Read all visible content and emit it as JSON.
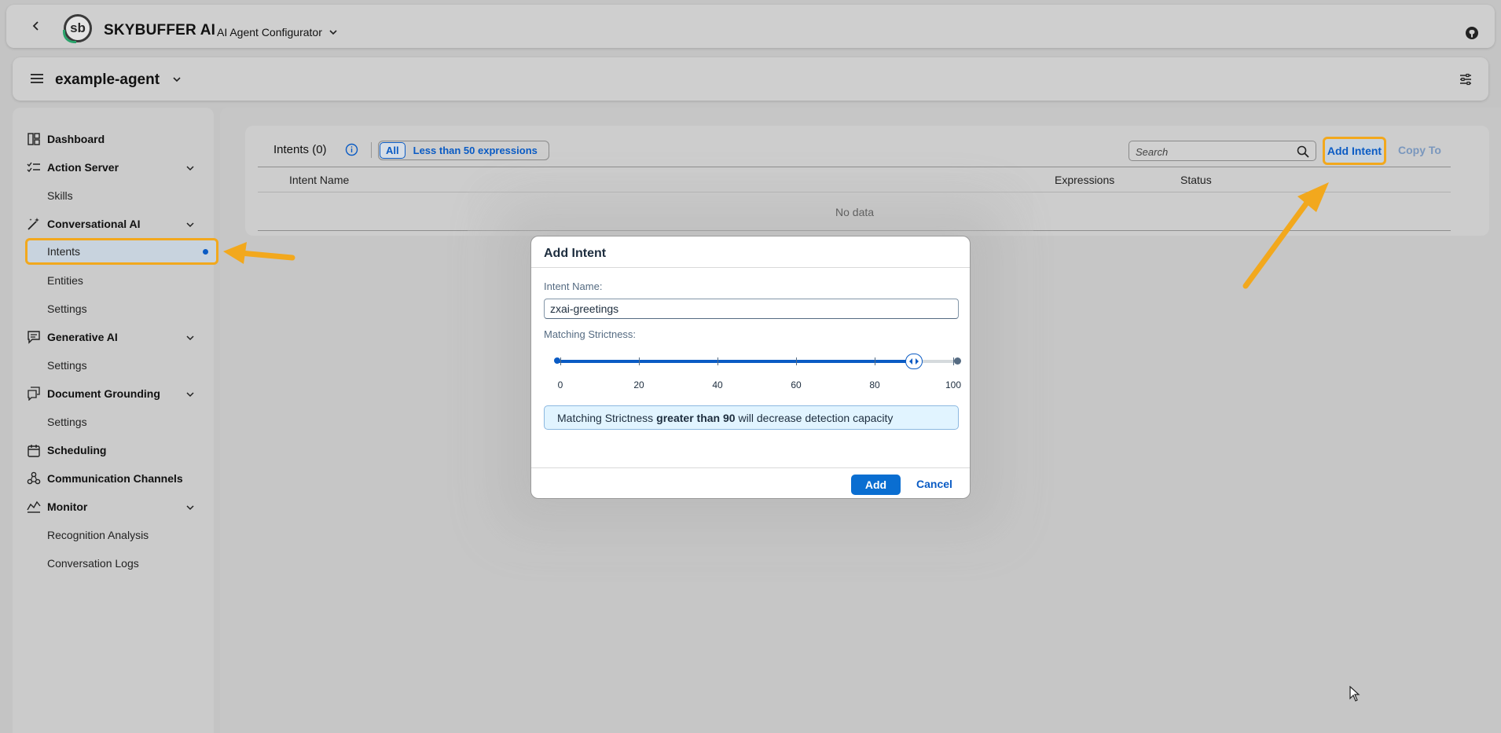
{
  "shellbar": {
    "brand": "SKYBUFFER AI",
    "logo_text": "sb",
    "product": "AI Agent Configurator"
  },
  "toolbar": {
    "agent_name": "example-agent"
  },
  "sidebar": {
    "items": [
      {
        "label": "Dashboard",
        "icon": "dashboard-icon"
      },
      {
        "label": "Action Server",
        "icon": "tasks-icon"
      },
      {
        "label": "Skills"
      },
      {
        "label": "Conversational AI",
        "icon": "magic-wand-icon"
      },
      {
        "label": "Intents"
      },
      {
        "label": "Entities"
      },
      {
        "label": "Settings"
      },
      {
        "label": "Generative AI",
        "icon": "chat-icon"
      },
      {
        "label": "Settings"
      },
      {
        "label": "Document Grounding",
        "icon": "document-chat-icon"
      },
      {
        "label": "Settings"
      },
      {
        "label": "Scheduling",
        "icon": "calendar-icon"
      },
      {
        "label": "Communication Channels",
        "icon": "channels-icon"
      },
      {
        "label": "Monitor",
        "icon": "monitor-chart-icon"
      },
      {
        "label": "Recognition Analysis"
      },
      {
        "label": "Conversation Logs"
      }
    ]
  },
  "table": {
    "title": "Intents (0)",
    "filter_all": "All",
    "filter_less": "Less than 50 expressions",
    "search_placeholder": "Search",
    "add_intent": "Add Intent",
    "copy_to": "Copy To",
    "columns": [
      "Intent Name",
      "Expressions",
      "Status"
    ],
    "empty_text": "No data"
  },
  "dialog": {
    "title": "Add Intent",
    "name_label": "Intent Name:",
    "name_value": "zxai-greetings",
    "strictness_label": "Matching Strictness:",
    "slider": {
      "value": 90,
      "min": 0,
      "max": 100,
      "ticks": [
        "0",
        "20",
        "40",
        "60",
        "80",
        "100"
      ]
    },
    "info_prefix": "Matching Strictness",
    "info_bold": "greater than 90",
    "info_suffix": "will decrease detection capacity",
    "add_label": "Add",
    "cancel_label": "Cancel"
  },
  "colors": {
    "accent": "#0a5bc4",
    "highlight": "#f2a81d"
  }
}
